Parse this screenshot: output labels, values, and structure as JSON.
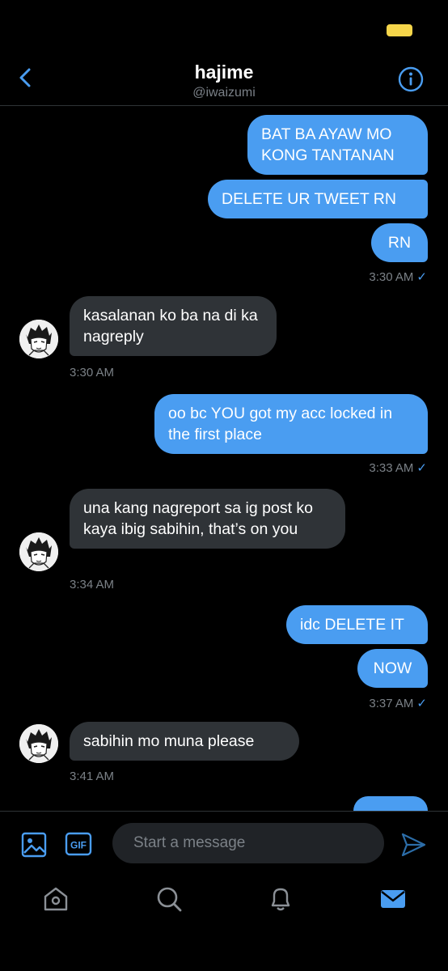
{
  "header": {
    "title": "hajime",
    "handle": "@iwaizumi"
  },
  "messages": [
    {
      "text": "BAT BA AYAW MO KONG TANTANAN"
    },
    {
      "text": "DELETE UR TWEET RN"
    },
    {
      "text": "RN",
      "time": "3:30 AM"
    },
    {
      "text": "kasalanan ko ba na di ka nagreply",
      "time": "3:30 AM"
    },
    {
      "text": "oo bc YOU got my acc locked in the first place",
      "time": "3:33 AM"
    },
    {
      "text": "una kang nagreport sa ig post ko kaya ibig sabihin, that’s on you",
      "time": "3:34 AM"
    },
    {
      "text": "idc DELETE IT"
    },
    {
      "text": "NOW",
      "time": "3:37 AM"
    },
    {
      "text": "sabihin mo muna please",
      "time": "3:41 AM"
    }
  ],
  "read_check": "✓",
  "composer": {
    "placeholder": "Start a message",
    "gif_label": "GIF"
  },
  "tabs": [
    "home-icon",
    "search-icon",
    "notifications-icon",
    "messages-icon"
  ],
  "colors": {
    "accent": "#4a9df1",
    "incoming": "#2f3337",
    "battery": "#f5d54a"
  }
}
